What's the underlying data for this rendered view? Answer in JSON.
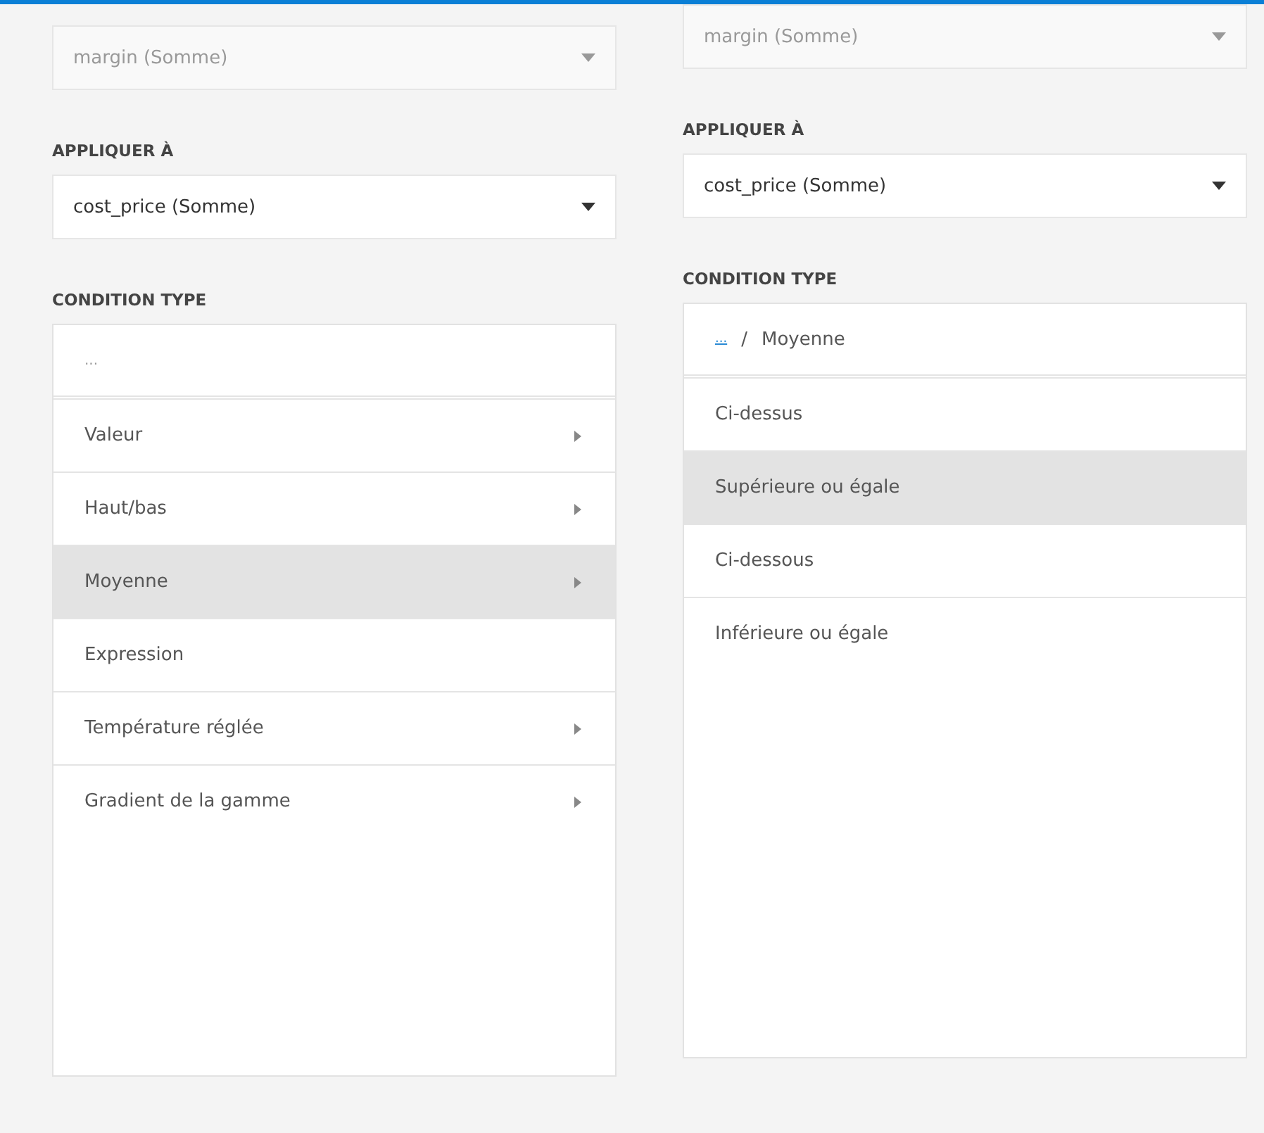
{
  "panels": [
    {
      "field": {
        "value": "margin (Somme)",
        "disabled": true
      },
      "apply_label": "APPLIQUER À",
      "apply": {
        "value": "cost_price (Somme)",
        "disabled": false
      },
      "condition_label": "CONDITION TYPE",
      "crumbs": [
        {
          "label": "...",
          "link": false
        }
      ],
      "items": [
        {
          "label": "Valeur",
          "submenu": true,
          "selected": false
        },
        {
          "label": "Haut/bas",
          "submenu": true,
          "selected": false
        },
        {
          "label": "Moyenne",
          "submenu": true,
          "selected": true
        },
        {
          "label": "Expression",
          "submenu": false,
          "selected": false
        },
        {
          "label": "Température réglée",
          "submenu": true,
          "selected": false
        },
        {
          "label": "Gradient de la gamme",
          "submenu": true,
          "selected": false
        }
      ]
    },
    {
      "field": {
        "value": "margin (Somme)",
        "disabled": true
      },
      "apply_label": "APPLIQUER À",
      "apply": {
        "value": "cost_price (Somme)",
        "disabled": false
      },
      "condition_label": "CONDITION TYPE",
      "crumb_separator": "/",
      "crumbs": [
        {
          "label": "...",
          "link": true
        },
        {
          "label": "Moyenne",
          "link": false
        }
      ],
      "items": [
        {
          "label": "Ci-dessus",
          "submenu": false,
          "selected": false
        },
        {
          "label": "Supérieure ou égale",
          "submenu": false,
          "selected": true
        },
        {
          "label": "Ci-dessous",
          "submenu": false,
          "selected": false
        },
        {
          "label": "Inférieure ou égale",
          "submenu": false,
          "selected": false
        }
      ]
    }
  ]
}
